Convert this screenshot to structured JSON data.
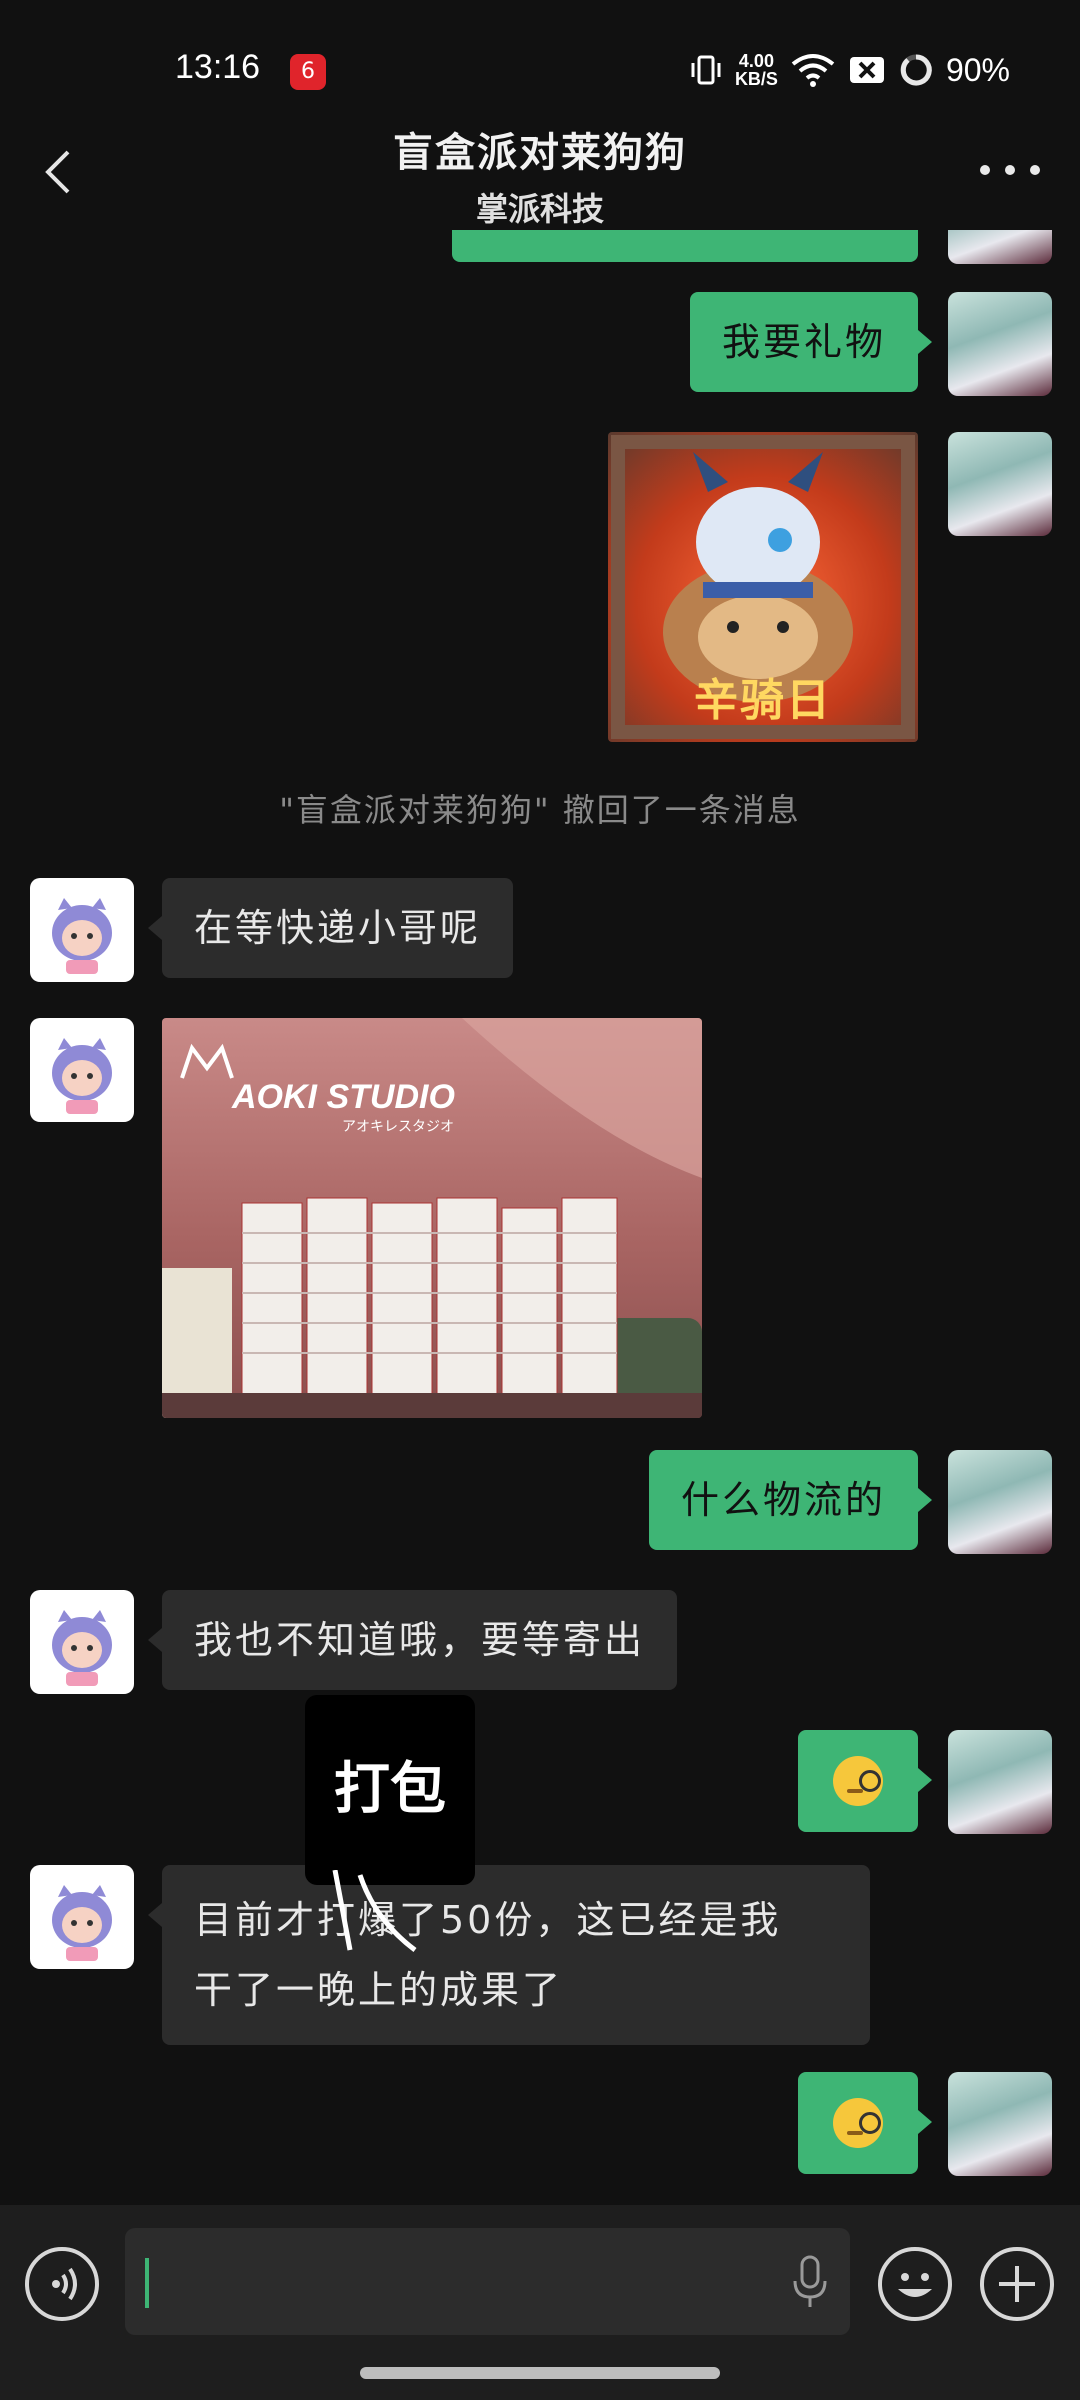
{
  "status_bar": {
    "time": "13:16",
    "app_badge": "6",
    "net_speed_value": "4.00",
    "net_speed_unit": "KB/S",
    "battery": "90%"
  },
  "header": {
    "title": "盲盒派对莱狗狗",
    "subtitle": "掌派科技"
  },
  "messages": {
    "m1_text": "我要礼物",
    "sticker_caption": "辛骑日",
    "recall_note": "\"盲盒派对莱狗狗\" 撤回了一条消息",
    "m2_text": "在等快递小哥呢",
    "photo_sign": "AOKI STUDIO",
    "photo_sign_sub": "アオキレスタジオ",
    "m3_text": "什么物流的",
    "m4_text": "我也不知道哦，要等寄出",
    "m5_line1": "目前才打爆了50份，这已经是我",
    "m5_line2": "干了一晚上的成果了",
    "overlay_text": "打包"
  },
  "icons": {
    "app_badge": "netease-music-icon",
    "vibrate": "vibrate-icon",
    "wifi": "wifi-icon",
    "sim": "sim-off-icon",
    "battery": "battery-ring-icon",
    "back": "chevron-left-icon",
    "more": "more-dots-icon",
    "voice": "voice-icon",
    "mic": "microphone-icon",
    "emoji": "emoji-icon",
    "plus": "plus-icon",
    "emoji_face": "monocle-face-emoji"
  },
  "colors": {
    "bubble_self": "#3eb575",
    "bubble_other": "#2c2c2c",
    "background": "#111111"
  }
}
